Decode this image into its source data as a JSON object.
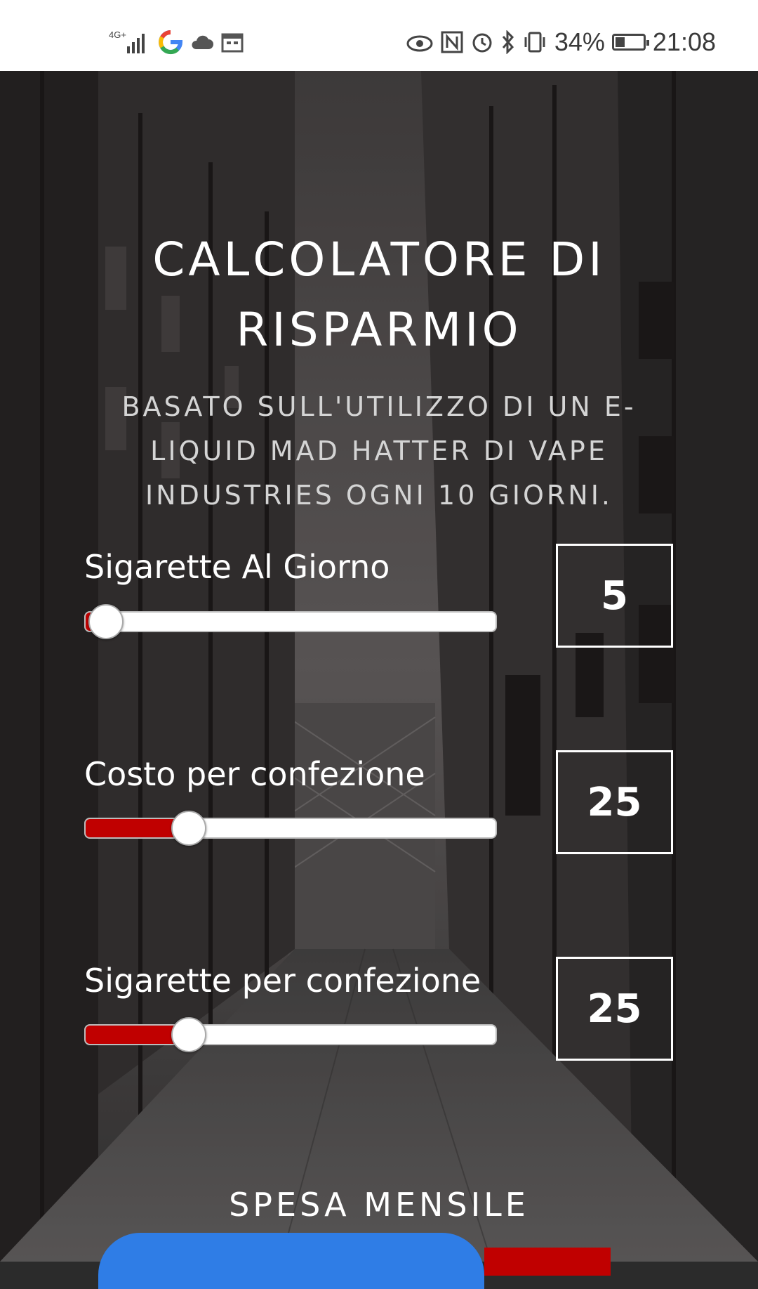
{
  "status_bar": {
    "network": "4G+",
    "battery_percent": "34%",
    "battery_level": 0.34,
    "time": "21:08",
    "left_icons": [
      "signal-icon",
      "google-icon",
      "cloud-icon",
      "calendar-icon"
    ],
    "right_icons": [
      "eye-icon",
      "nfc-icon",
      "alarm-icon",
      "bluetooth-icon",
      "vibrate-icon"
    ]
  },
  "header": {
    "title_line1": "CALCOLATORE DI",
    "title_line2": "RISPARMIO",
    "subtitle_line1": "BASATO SULL'UTILIZZO DI UN E-",
    "subtitle_line2": "LIQUID MAD HATTER DI VAPE",
    "subtitle_line3": "INDUSTRIES OGNI 10 GIORNI."
  },
  "sliders": [
    {
      "label": "Sigarette Al Giorno",
      "value": "5",
      "position": 0.05
    },
    {
      "label": "Costo per confezione",
      "value": "25",
      "position": 0.25
    },
    {
      "label": "Sigarette per confezione",
      "value": "25",
      "position": 0.25
    }
  ],
  "result": {
    "heading": "SPESA MENSILE"
  },
  "colors": {
    "accent_red": "#c00000",
    "accent_blue": "#2f7de6",
    "text_white": "#ffffff"
  }
}
